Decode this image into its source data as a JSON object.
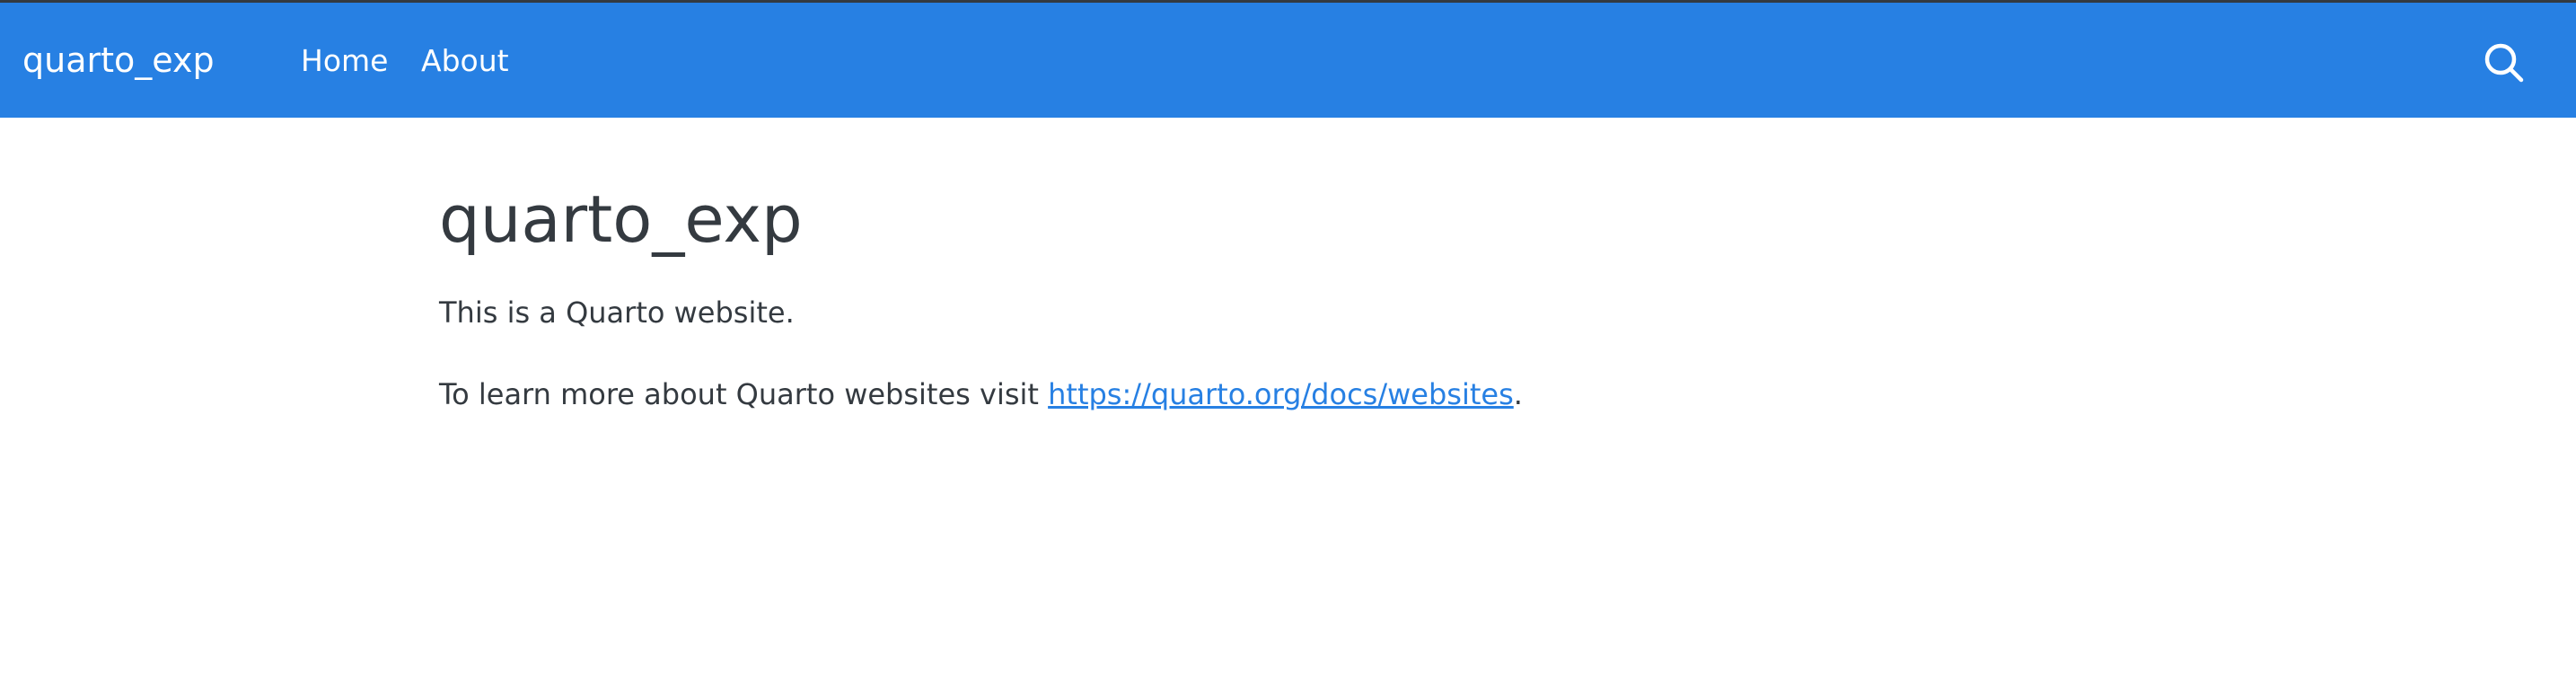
{
  "navbar": {
    "brand": "quarto_exp",
    "links": [
      {
        "label": "Home"
      },
      {
        "label": "About"
      }
    ],
    "search_icon": "search-icon",
    "background_color": "#2780e3",
    "text_color": "#ffffff"
  },
  "main": {
    "title": "quarto_exp",
    "paragraph_1": "This is a Quarto website.",
    "paragraph_2_prefix": "To learn more about Quarto websites visit ",
    "paragraph_2_link": "https://quarto.org/docs/websites",
    "paragraph_2_suffix": ".",
    "link_color": "#2780e3",
    "text_color": "#343a40"
  }
}
